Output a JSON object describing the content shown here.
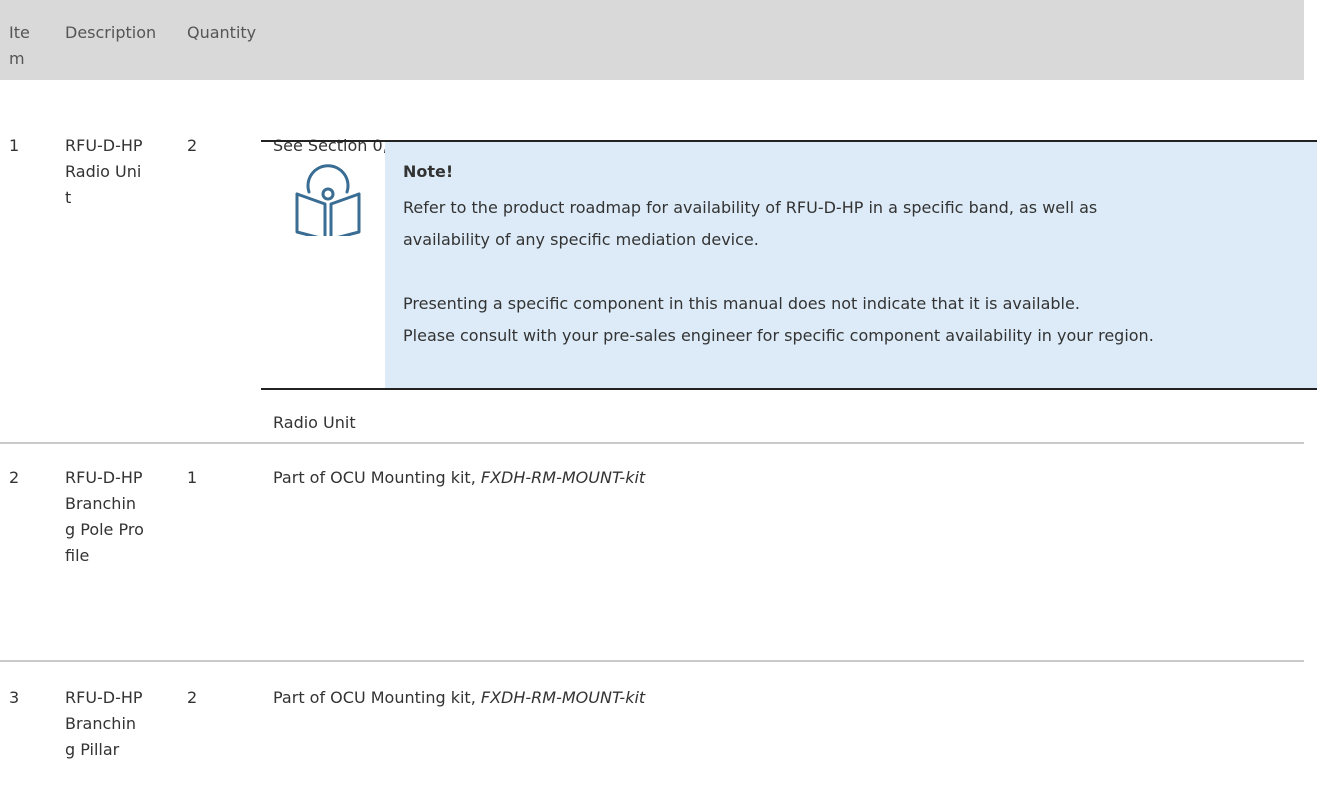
{
  "table": {
    "headers": [
      "Item",
      "Description",
      "Quantity",
      ""
    ],
    "rows": [
      {
        "item": "1",
        "description": "RFU-D-HP Radio Unit",
        "quantity": "2",
        "details_before": "See Section 0,",
        "details_after": "Radio Unit"
      },
      {
        "item": "2",
        "description": "RFU-D-HP Branching Pole Profile",
        "quantity": "1",
        "details_text": "Part of OCU Mounting kit, ",
        "details_italic": "FXDH-RM-MOUNT-kit"
      },
      {
        "item": "3",
        "description": "RFU-D-HP Branching Pillar",
        "quantity": "2",
        "details_text": "Part of OCU Mounting kit, ",
        "details_italic": "FXDH-RM-MOUNT-kit"
      }
    ]
  },
  "note": {
    "icon": "book-disc-icon",
    "title": "Note!",
    "lines": [
      "Refer to the product roadmap for availability of RFU-D-HP in a specific band, as well as",
      "availability of any specific mediation device.",
      "Presenting a specific component in this manual does not indicate that it is available.",
      "Please consult with your pre-sales engineer for specific component availability in your region."
    ]
  },
  "colors": {
    "header_bg": "#d9d9d9",
    "note_bg": "#dcebf7",
    "icon_stroke": "#3a6d93",
    "text": "#333333"
  }
}
